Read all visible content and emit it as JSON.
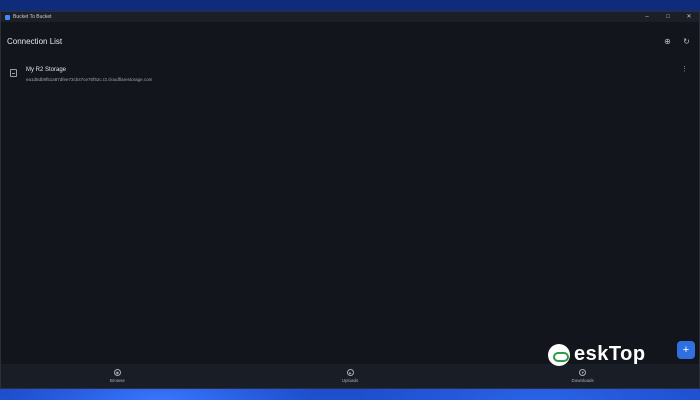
{
  "window": {
    "title": "Bucket To Bucket",
    "controls": {
      "minimize": "–",
      "maximize": "□",
      "close": "✕"
    }
  },
  "header": {
    "title": "Connection List",
    "actions": [
      {
        "icon": "add-connection-icon",
        "glyph": "⊕"
      },
      {
        "icon": "refresh-icon",
        "glyph": "↻"
      }
    ]
  },
  "connections": [
    {
      "name": "My R2 Storage",
      "host": "ea1d5db9f51a87dfee73cb47ce75f52c.r2.cloudflarestorage.com",
      "menu_glyph": "⋮"
    }
  ],
  "fab": {
    "label": "+"
  },
  "bottom_nav": [
    {
      "label": "Browse",
      "icon": "compass-icon",
      "glyph": "◉"
    },
    {
      "label": "Uploads",
      "icon": "upload-icon",
      "glyph": "▲"
    },
    {
      "label": "Downloads",
      "icon": "download-icon",
      "glyph": "▼"
    }
  ],
  "watermark": {
    "text": "eskTop"
  },
  "colors": {
    "app_bg": "#12151c",
    "accent": "#2f6fe0",
    "text_primary": "#e4e6eb",
    "text_secondary": "#9ea3ac"
  }
}
